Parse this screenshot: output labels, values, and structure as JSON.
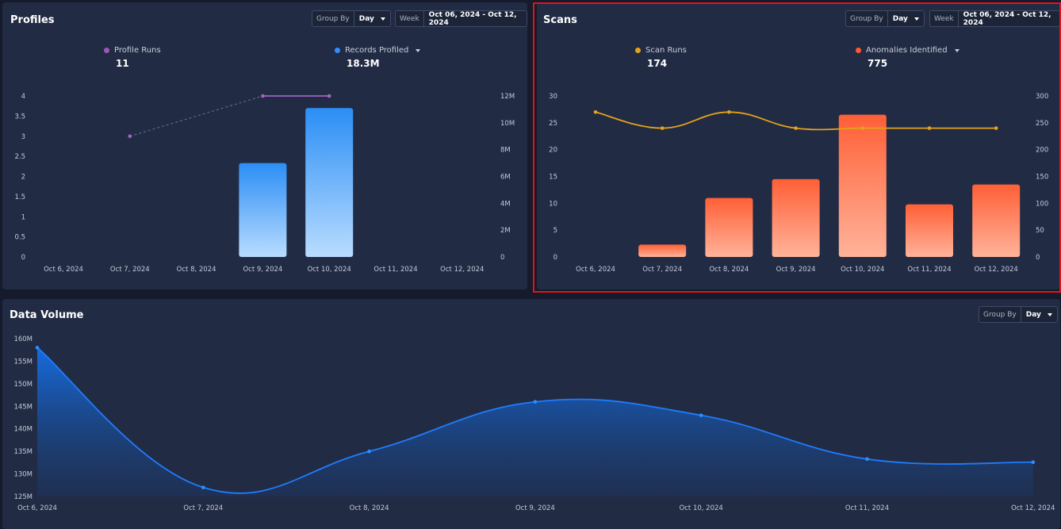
{
  "profiles": {
    "title": "Profiles",
    "group_by": {
      "label": "Group By",
      "value": "Day"
    },
    "week": {
      "label": "Week",
      "value": "Oct 06, 2024 - Oct 12, 2024"
    },
    "legend": [
      {
        "label": "Profile Runs",
        "value": "11",
        "color": "#9b59b6"
      },
      {
        "label": "Records Profiled",
        "value": "18.3M",
        "color": "#2f8fff"
      }
    ]
  },
  "scans": {
    "title": "Scans",
    "group_by": {
      "label": "Group By",
      "value": "Day"
    },
    "week": {
      "label": "Week",
      "value": "Oct 06, 2024 - Oct 12, 2024"
    },
    "legend": [
      {
        "label": "Scan Runs",
        "value": "174",
        "color": "#e3a21a"
      },
      {
        "label": "Anomalies Identified",
        "value": "775",
        "color": "#ff5a30"
      }
    ]
  },
  "data_volume": {
    "title": "Data Volume",
    "group_by": {
      "label": "Group By",
      "value": "Day"
    }
  },
  "chart_data": [
    {
      "id": "profiles",
      "type": "bar",
      "categories": [
        "Oct 6, 2024",
        "Oct 7, 2024",
        "Oct 8, 2024",
        "Oct 9, 2024",
        "Oct 10, 2024",
        "Oct 11, 2024",
        "Oct 12, 2024"
      ],
      "left_ticks": [
        "0",
        "0.5",
        "1",
        "1.5",
        "2",
        "2.5",
        "3",
        "3.5",
        "4"
      ],
      "right_ticks": [
        "0",
        "2M",
        "4M",
        "6M",
        "8M",
        "10M",
        "12M"
      ],
      "ylim_left": [
        0,
        4
      ],
      "ylim_right": [
        0,
        12000000
      ],
      "series": [
        {
          "name": "Records Profiled",
          "type": "bar",
          "axis": "right",
          "color": "#2f8fff",
          "values": [
            null,
            null,
            null,
            7000000,
            11100000,
            null,
            null
          ]
        },
        {
          "name": "Profile Runs",
          "type": "line",
          "axis": "left",
          "color": "#a463c8",
          "values": [
            null,
            3,
            null,
            4,
            4,
            null,
            null
          ]
        }
      ]
    },
    {
      "id": "scans",
      "type": "bar",
      "categories": [
        "Oct 6, 2024",
        "Oct 7, 2024",
        "Oct 8, 2024",
        "Oct 9, 2024",
        "Oct 10, 2024",
        "Oct 11, 2024",
        "Oct 12, 2024"
      ],
      "left_ticks": [
        "0",
        "5",
        "10",
        "15",
        "20",
        "25",
        "30"
      ],
      "right_ticks": [
        "0",
        "50",
        "100",
        "150",
        "200",
        "250",
        "300"
      ],
      "ylim_left": [
        0,
        30
      ],
      "ylim_right": [
        0,
        300
      ],
      "series": [
        {
          "name": "Anomalies Identified",
          "type": "bar",
          "axis": "right",
          "color": "#ff5a30",
          "values": [
            0,
            23,
            110,
            145,
            265,
            98,
            135
          ]
        },
        {
          "name": "Scan Runs",
          "type": "line",
          "axis": "left",
          "color": "#e3a21a",
          "values": [
            27,
            24,
            27,
            24,
            24,
            24,
            24
          ]
        }
      ]
    },
    {
      "id": "data_volume",
      "type": "area",
      "categories": [
        "Oct 6, 2024",
        "Oct 7, 2024",
        "Oct 8, 2024",
        "Oct 9, 2024",
        "Oct 10, 2024",
        "Oct 11, 2024",
        "Oct 12, 2024"
      ],
      "ticks": [
        "125M",
        "130M",
        "135M",
        "140M",
        "145M",
        "150M",
        "155M",
        "160M"
      ],
      "ylim": [
        125,
        160
      ],
      "series": [
        {
          "color": "#1f7cff",
          "values": [
            158,
            127,
            135,
            146,
            143,
            133.3,
            132.6
          ]
        }
      ]
    }
  ]
}
